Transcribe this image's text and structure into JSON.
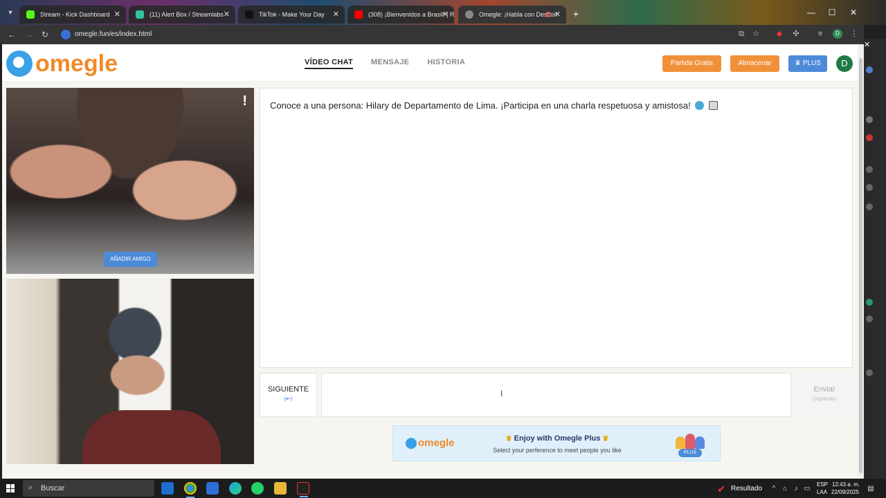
{
  "browser": {
    "tabs": [
      {
        "title": "Stream - Kick Dashboard",
        "favicon_color": "#53fc18"
      },
      {
        "title": "(11) Alert Box / Streamlabs",
        "favicon_color": "#31c3a2"
      },
      {
        "title": "TikTok - Make Your Day",
        "favicon_color": "#111111"
      },
      {
        "title": "(308) ¡Bienvenidos a Brasil! | R",
        "favicon_color": "#ff0000"
      },
      {
        "title": "Omegle: ¡Habla con Descon",
        "favicon_color": "#888888"
      }
    ],
    "active_tab": 4,
    "url": "omegle.fun/es/index.html",
    "profile_initial": "D"
  },
  "site": {
    "logo_text": "omegle",
    "nav": [
      "VÍDEO CHAT",
      "MENSAJE",
      "HISTORIA"
    ],
    "buttons": {
      "free_match": "Partida Gratis",
      "store": "Almacenar",
      "plus": "PLUS"
    },
    "avatar_initial": "D",
    "colors": {
      "brand_orange": "#f08a2a",
      "brand_blue": "#3aa0e8",
      "plus_blue": "#4d8ad8"
    }
  },
  "video": {
    "add_friend": "AÑADIR AMIGO",
    "report": "!"
  },
  "chat": {
    "message": "Conoce a una persona: Hilary de Departamento de Lima. ¡Participa en una charla respetuosa y amistosa!",
    "next_label": "SIGUIENTE",
    "next_key": "(⇤)",
    "send_label": "Enviar",
    "send_key": "(Ingresar)",
    "input_value": ""
  },
  "promo": {
    "logo_text": "omegle",
    "title": "Enjoy with Omegle Plus",
    "subtitle": "Select your perference to meet people you like",
    "badge": "PLUS"
  },
  "taskbar": {
    "search": "Buscar",
    "notification": "Resultado",
    "lang_top": "ESP",
    "lang_bottom": "LAA",
    "time": "12:43 a. m.",
    "date": "22/09/2025"
  }
}
